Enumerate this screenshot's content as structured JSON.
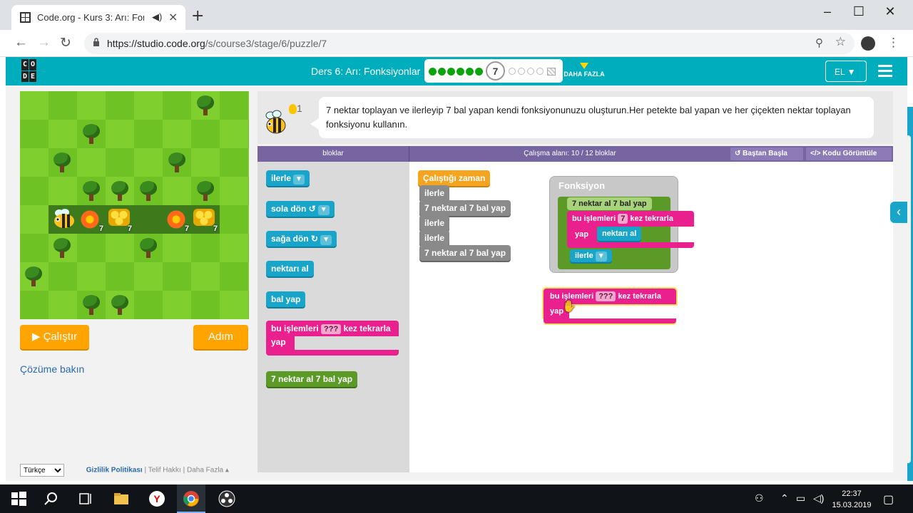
{
  "browser": {
    "tab_title": "Code.org - Kurs 3: Arı: Fonks",
    "url_domain": "https://studio.code.org",
    "url_path": "/s/course3/stage/6/puzzle/7",
    "new_tab_symbol": "+",
    "close_tab_symbol": "×"
  },
  "site": {
    "logo_letters": [
      "C",
      "O",
      "D",
      "E"
    ],
    "lesson_title": "Ders 6: Arı: Fonksiyonlar",
    "current_puzzle": "7",
    "completed_dots": 6,
    "remaining_dots": 4,
    "more_label": "DAHA FAZLA",
    "language": "EL"
  },
  "instructions": {
    "hint_count": "1",
    "text": "7 nektar toplayan ve ilerleyip 7 bal yapan kendi fonksiyonunuzu oluşturun.Her petekte bal yapan ve her çiçekten nektar toplayan fonksiyonu kullanın."
  },
  "workspace_header": {
    "toolbox_label": "bloklar",
    "workspace_label": "Çalışma alanı: 10 / 12 bloklar",
    "restart_label": "Baştan Başla",
    "show_code_label": "Kodu Görüntüle"
  },
  "game": {
    "counts": [
      "7",
      "7",
      "7",
      "7"
    ]
  },
  "controls": {
    "run_label": "Çalıştır",
    "step_label": "Adım",
    "solution_link": "Çözüme bakın"
  },
  "toolbox": {
    "move": "ilerle",
    "turn_left": "sola dön ↺",
    "turn_right": "sağa dön ↻",
    "get_nectar": "nektarı al",
    "make_honey": "bal yap",
    "repeat_prefix": "bu işlemleri",
    "repeat_slot": "???",
    "repeat_suffix": "kez tekrarla",
    "repeat_do": "yap",
    "function_call": "7 nektar al 7 bal yap"
  },
  "program": {
    "when_run": "Çalıştığı zaman",
    "steps": [
      "ilerle",
      "7 nektar al 7 bal yap",
      "ilerle",
      "ilerle",
      "7 nektar al 7 bal yap"
    ]
  },
  "function_def": {
    "title": "Fonksiyon",
    "name": "7 nektar al 7 bal yap",
    "repeat_prefix": "bu işlemleri",
    "repeat_count": "7",
    "repeat_suffix": "kez tekrarla",
    "repeat_do": "yap",
    "inner": "nektarı al",
    "after": "ilerle"
  },
  "floating_block": {
    "prefix": "bu işlemleri",
    "slot": "???",
    "suffix": "kez tekrarla",
    "do": "yap"
  },
  "footer": {
    "language": "Türkçe",
    "privacy": "Gizlilik Politikası",
    "copyright": "Telif Hakkı",
    "more": "Daha Fazla ▴"
  },
  "taskbar": {
    "time": "22:37",
    "date": "15.03.2019"
  },
  "colors": {
    "header": "#00adbc",
    "purple": "#7665a0",
    "cyan_block": "#19a5c9",
    "pink_block": "#e9208d",
    "green_block": "#5b9a27",
    "run_button": "#ffa400"
  }
}
